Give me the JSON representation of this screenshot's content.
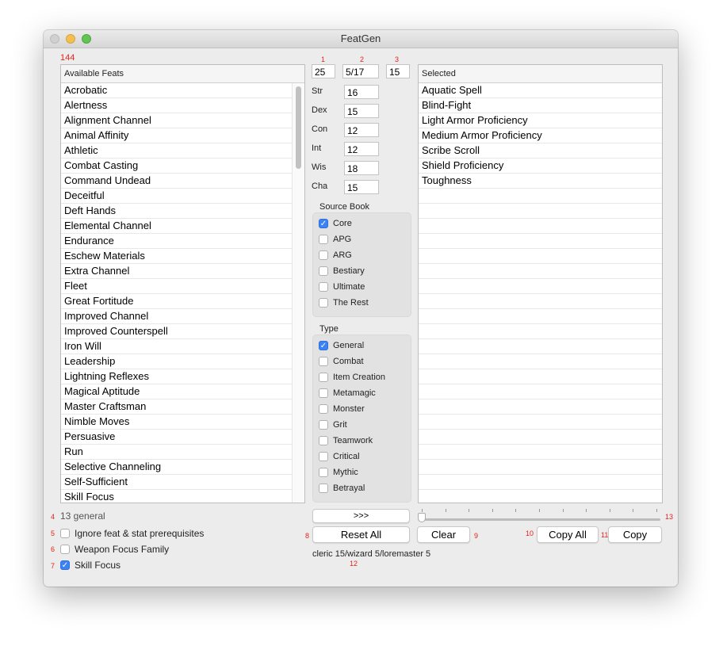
{
  "window": {
    "title": "FeatGen"
  },
  "counts": {
    "available": "144",
    "n1": "1",
    "n2": "2",
    "n3": "3",
    "n4": "4",
    "n5": "5",
    "n6": "6",
    "n7": "7",
    "n8": "8",
    "n9": "9",
    "n10": "10",
    "n11": "11",
    "n12": "12",
    "n13": "13"
  },
  "available": {
    "header": "Available Feats",
    "items": [
      "Acrobatic",
      "Alertness",
      "Alignment Channel",
      "Animal Affinity",
      "Athletic",
      "Combat Casting",
      "Command Undead",
      "Deceitful",
      "Deft Hands",
      "Elemental Channel",
      "Endurance",
      "Eschew Materials",
      "Extra Channel",
      "Fleet",
      "Great Fortitude",
      "Improved Channel",
      "Improved Counterspell",
      "Iron Will",
      "Leadership",
      "Lightning Reflexes",
      "Magical Aptitude",
      "Master Craftsman",
      "Nimble Moves",
      "Persuasive",
      "Run",
      "Selective Channeling",
      "Self-Sufficient",
      "Skill Focus"
    ]
  },
  "top_fields": {
    "level": "25",
    "feats": "5/17",
    "hd": "15"
  },
  "stats": [
    {
      "label": "Str",
      "value": "16"
    },
    {
      "label": "Dex",
      "value": "15"
    },
    {
      "label": "Con",
      "value": "12"
    },
    {
      "label": "Int",
      "value": "12"
    },
    {
      "label": "Wis",
      "value": "18"
    },
    {
      "label": "Cha",
      "value": "15"
    }
  ],
  "source_book": {
    "title": "Source Book",
    "items": [
      {
        "label": "Core",
        "checked": true
      },
      {
        "label": "APG",
        "checked": false
      },
      {
        "label": "ARG",
        "checked": false
      },
      {
        "label": "Bestiary",
        "checked": false
      },
      {
        "label": "Ultimate",
        "checked": false
      },
      {
        "label": "The Rest",
        "checked": false
      }
    ]
  },
  "type": {
    "title": "Type",
    "items": [
      {
        "label": "General",
        "checked": true
      },
      {
        "label": "Combat",
        "checked": false
      },
      {
        "label": "Item Creation",
        "checked": false
      },
      {
        "label": "Metamagic",
        "checked": false
      },
      {
        "label": "Monster",
        "checked": false
      },
      {
        "label": "Grit",
        "checked": false
      },
      {
        "label": "Teamwork",
        "checked": false
      },
      {
        "label": "Critical",
        "checked": false
      },
      {
        "label": "Mythic",
        "checked": false
      },
      {
        "label": "Betrayal",
        "checked": false
      }
    ]
  },
  "selected": {
    "header": "Selected",
    "items": [
      "Aquatic Spell",
      "Blind-Fight",
      "Light Armor Proficiency",
      "Medium Armor Proficiency",
      "Scribe Scroll",
      "Shield Proficiency",
      "Toughness"
    ]
  },
  "footer": {
    "status": "13 general",
    "ignore_prereq": "Ignore feat & stat prerequisites",
    "weapon_focus": "Weapon Focus Family",
    "skill_focus": "Skill Focus",
    "add_btn": ">>>",
    "reset_btn": "Reset All",
    "clear_btn": "Clear",
    "copy_all_btn": "Copy All",
    "copy_btn": "Copy",
    "classes": "cleric 15/wizard 5/loremaster 5",
    "slider_value": 0
  },
  "accent": "#3b82f6"
}
